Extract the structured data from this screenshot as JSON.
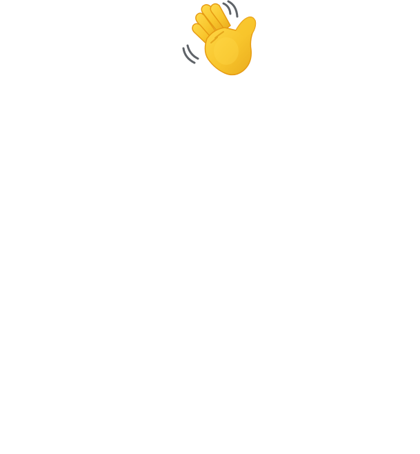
{
  "content": {
    "icon": "waving-hand-icon"
  },
  "colors": {
    "background": "#ffffff",
    "hand_fill": "#F8C52C",
    "hand_highlight": "#FFD94A",
    "hand_shadow": "#E2A21A",
    "hand_outline": "#E69A12",
    "motion_lines": "#5F6368"
  }
}
